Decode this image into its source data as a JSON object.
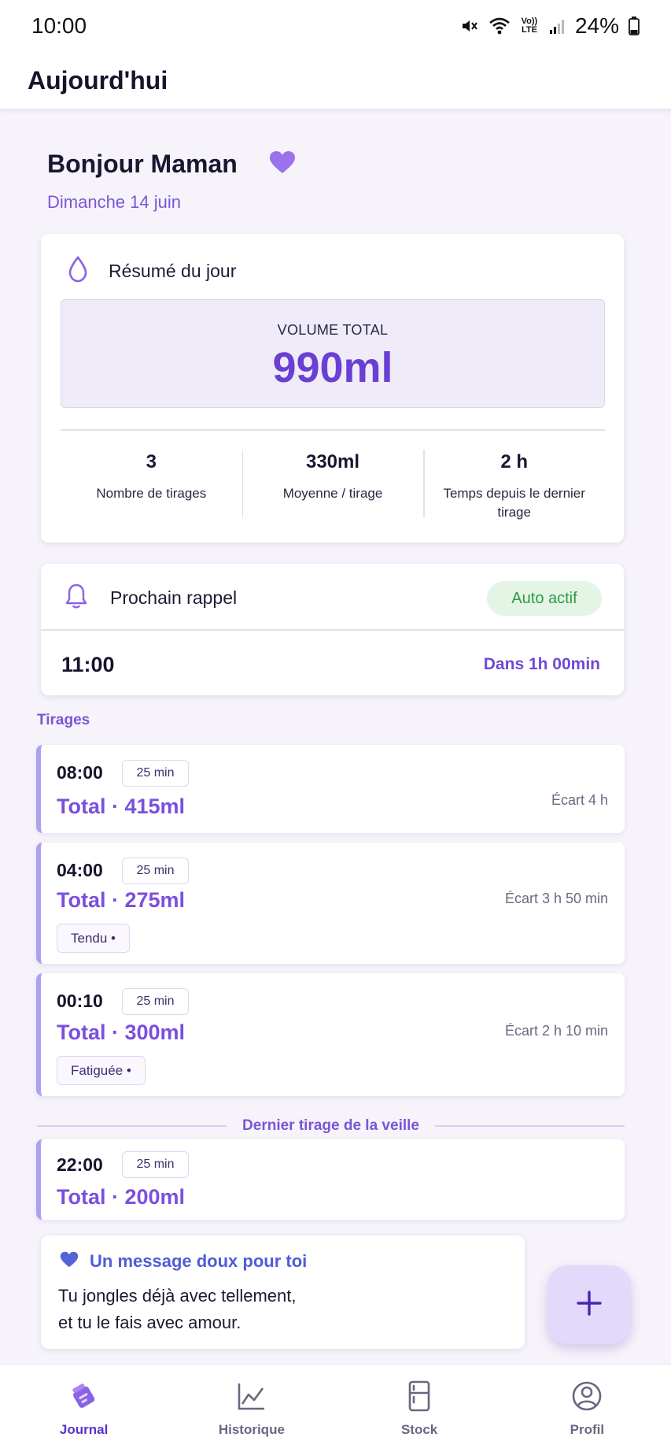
{
  "status_bar": {
    "time": "10:00",
    "volte": "Vo)) LTE",
    "battery": "24%"
  },
  "app_bar": {
    "title": "Aujourd'hui"
  },
  "greeting": {
    "text": "Bonjour Maman",
    "date": "Dimanche 14 juin"
  },
  "summary": {
    "title": "Résumé du jour",
    "total_label": "VOLUME TOTAL",
    "total_value": "990ml",
    "stats": [
      {
        "value": "3",
        "label": "Nombre de tirages"
      },
      {
        "value": "330ml",
        "label": "Moyenne / tirage"
      },
      {
        "value": "2 h",
        "label": "Temps depuis le dernier tirage"
      }
    ]
  },
  "reminder": {
    "title": "Prochain rappel",
    "badge": "Auto actif",
    "time": "11:00",
    "eta": "Dans 1h 00min"
  },
  "sessions_label": "Tirages",
  "sessions": [
    {
      "time": "08:00",
      "duration": "25 min",
      "total": "Total · 415ml",
      "gap": "Écart 4 h"
    },
    {
      "time": "04:00",
      "duration": "25 min",
      "total": "Total · 275ml",
      "gap": "Écart 3 h 50 min",
      "tag": "Tendu •"
    },
    {
      "time": "00:10",
      "duration": "25 min",
      "total": "Total · 300ml",
      "gap": "Écart 2 h 10 min",
      "tag": "Fatiguée •"
    }
  ],
  "previous_day": {
    "label": "Dernier tirage de la veille",
    "session": {
      "time": "22:00",
      "duration": "25 min",
      "total": "Total · 200ml"
    }
  },
  "message": {
    "title": "Un message doux pour toi",
    "line1": "Tu jongles déjà avec tellement,",
    "line2": "et tu le fais avec amour."
  },
  "fab": {
    "icon": "plus-icon"
  },
  "nav": [
    {
      "label": "Journal",
      "icon": "journal-icon",
      "active": true
    },
    {
      "label": "Historique",
      "icon": "chart-icon",
      "active": false
    },
    {
      "label": "Stock",
      "icon": "fridge-icon",
      "active": false
    },
    {
      "label": "Profil",
      "icon": "profile-icon",
      "active": false
    }
  ],
  "colors": {
    "accent": "#6a3fd3",
    "accent_light": "#b19ff0",
    "success": "#2f9a45",
    "background": "#f6f3fb"
  }
}
